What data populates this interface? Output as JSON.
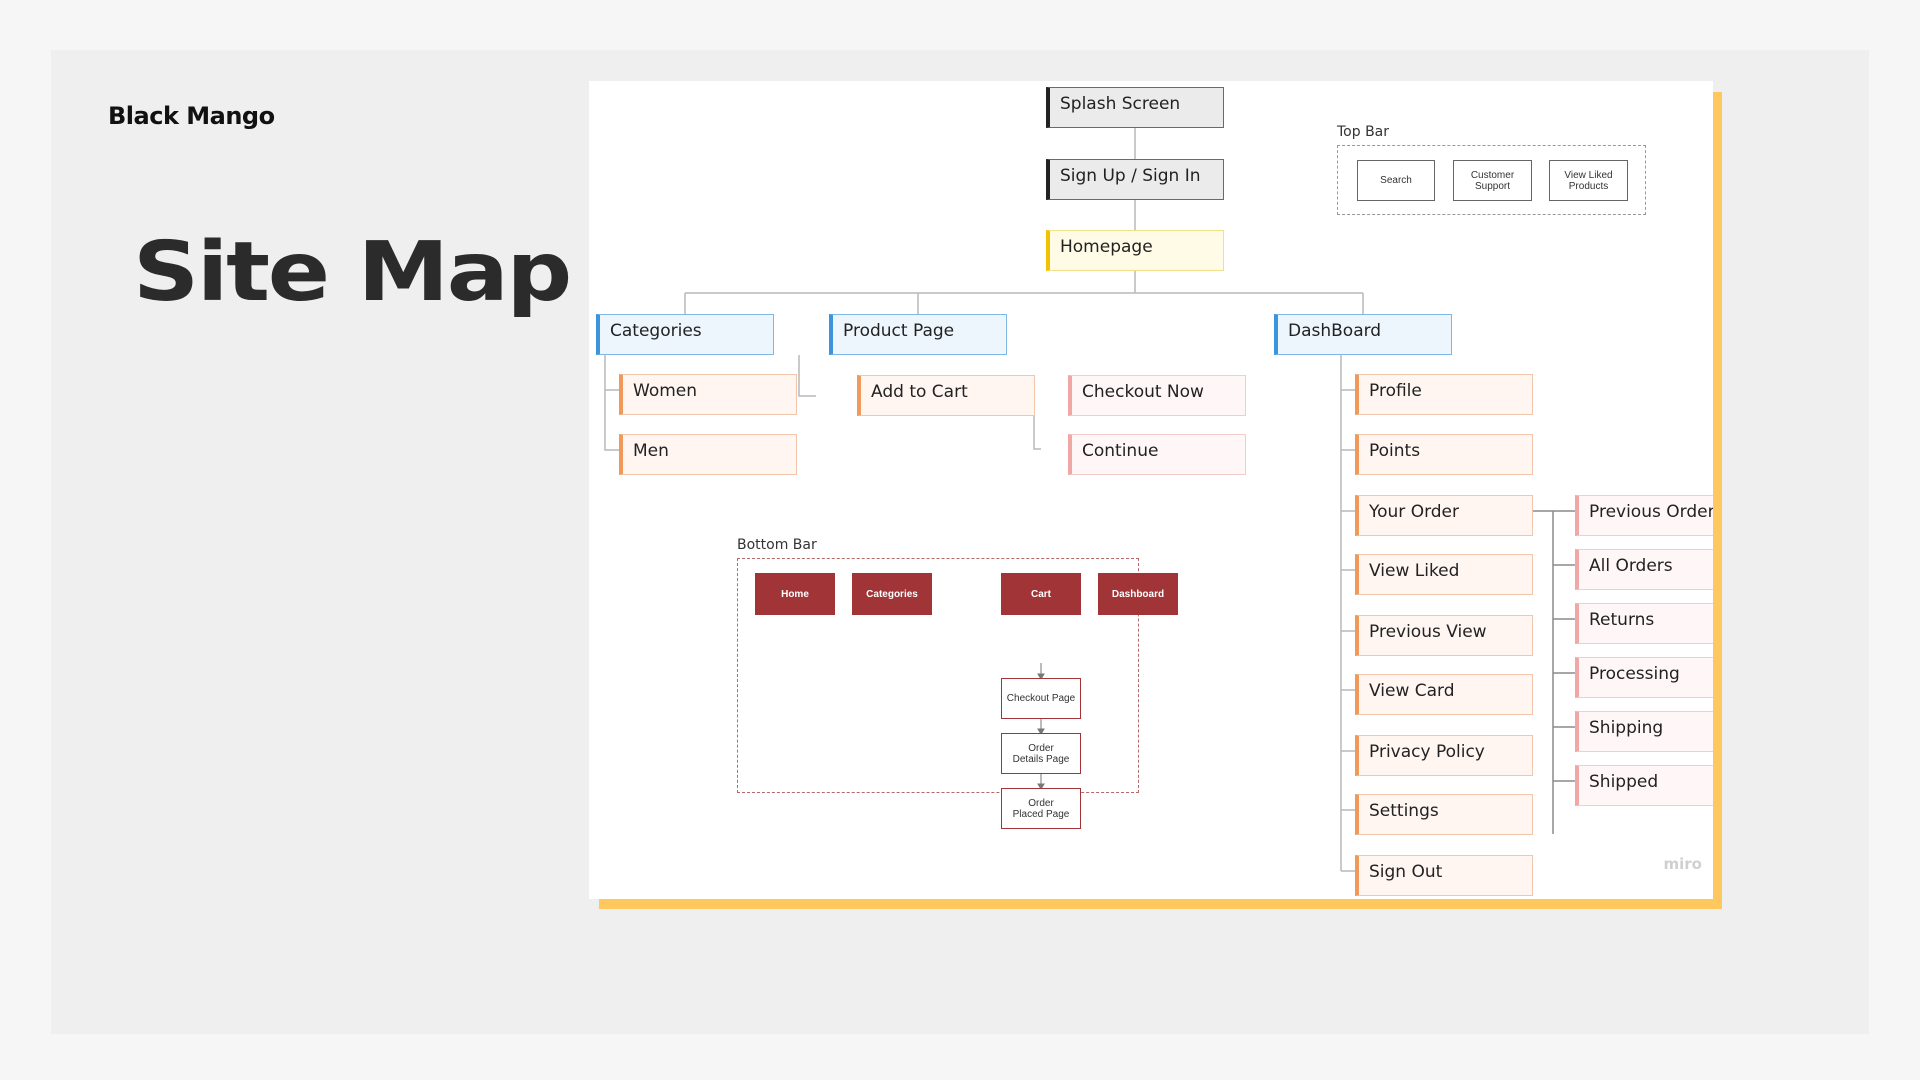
{
  "brand": "Black Mango",
  "title": "Site Map",
  "watermark": "miro",
  "colors": {
    "board_shadow": "#ffc85e",
    "bottom_bar_button": "#a03437"
  },
  "nodes": {
    "splash": "Splash Screen",
    "signup": "Sign Up / Sign In",
    "homepage": "Homepage",
    "categories": "Categories",
    "women": "Women",
    "men": "Men",
    "product_page": "Product Page",
    "add_to_cart": "Add to Cart",
    "checkout_now": "Checkout Now",
    "continue": "Continue",
    "dashboard": "DashBoard",
    "dashboard_items": [
      "Profile",
      "Points",
      "Your Order",
      "View Liked",
      "Previous View",
      "View Card",
      "Privacy Policy",
      "Settings",
      "Sign Out"
    ],
    "order_items": [
      "Previous Order",
      "All Orders",
      "Returns",
      "Processing",
      "Shipping",
      "Shipped"
    ]
  },
  "top_bar": {
    "label": "Top Bar",
    "items": [
      "Search",
      "Customer Support",
      "View Liked Products"
    ]
  },
  "bottom_bar": {
    "label": "Bottom Bar",
    "buttons": [
      "Home",
      "Categories",
      "Cart",
      "Dashboard"
    ],
    "cart_flow": [
      "Checkout Page",
      "Order Details Page",
      "Order Placed Page"
    ]
  }
}
